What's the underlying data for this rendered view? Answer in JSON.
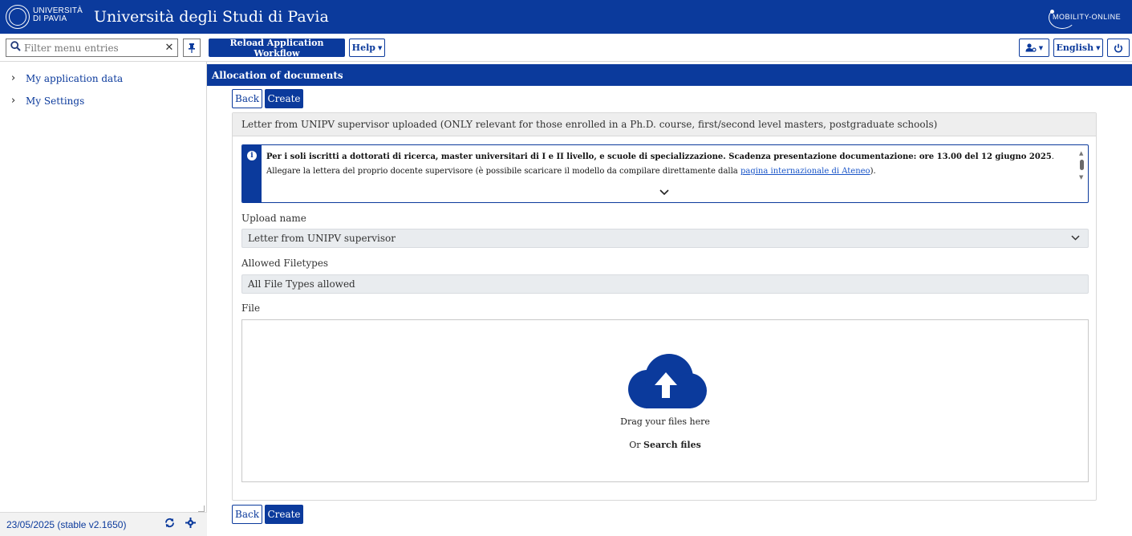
{
  "header": {
    "logo_line1": "UNIVERSITÀ",
    "logo_line2": "DI PAVIA",
    "title": "Università degli Studi di Pavia",
    "brand": "MOBILITY-ONLINE"
  },
  "toolbar": {
    "filter_placeholder": "Filter menu entries",
    "reload_label": "Reload Application Workflow",
    "help_label": "Help",
    "language_label": "English"
  },
  "sidebar": {
    "items": [
      {
        "label": "My application data"
      },
      {
        "label": "My Settings"
      }
    ],
    "footer_version": "23/05/2025 (stable v2.1650)"
  },
  "main": {
    "section_title": "Allocation of documents",
    "back_label": "Back",
    "create_label": "Create",
    "panel_title": "Letter from UNIPV supervisor uploaded (ONLY relevant for those enrolled in a Ph.D. course, first/second level masters, postgraduate schools)",
    "info_bold": "Per i soli iscritti a dottorati di ricerca, master universitari di I e II livello, e scuole di specializzazione. Scadenza presentazione documentazione: ore 13.00 del 12 giugno 2025",
    "info_bold_end": ".",
    "info_text_before": "Allegare la lettera del proprio docente supervisore (è possibile scaricare il modello da compilare direttamente dalla ",
    "info_link": "pagina internazionale di Ateneo",
    "info_text_after": ").",
    "upload_name_label": "Upload name",
    "upload_name_value": "Letter from UNIPV supervisor",
    "allowed_filetypes_label": "Allowed Filetypes",
    "allowed_filetypes_value": "All File Types allowed",
    "file_label": "File",
    "drag_text": "Drag your files here",
    "or_text": "Or",
    "search_files": "Search files"
  },
  "colors": {
    "primary": "#0b3a9c",
    "link": "#1a55c8",
    "field_bg": "#e9ecef"
  }
}
